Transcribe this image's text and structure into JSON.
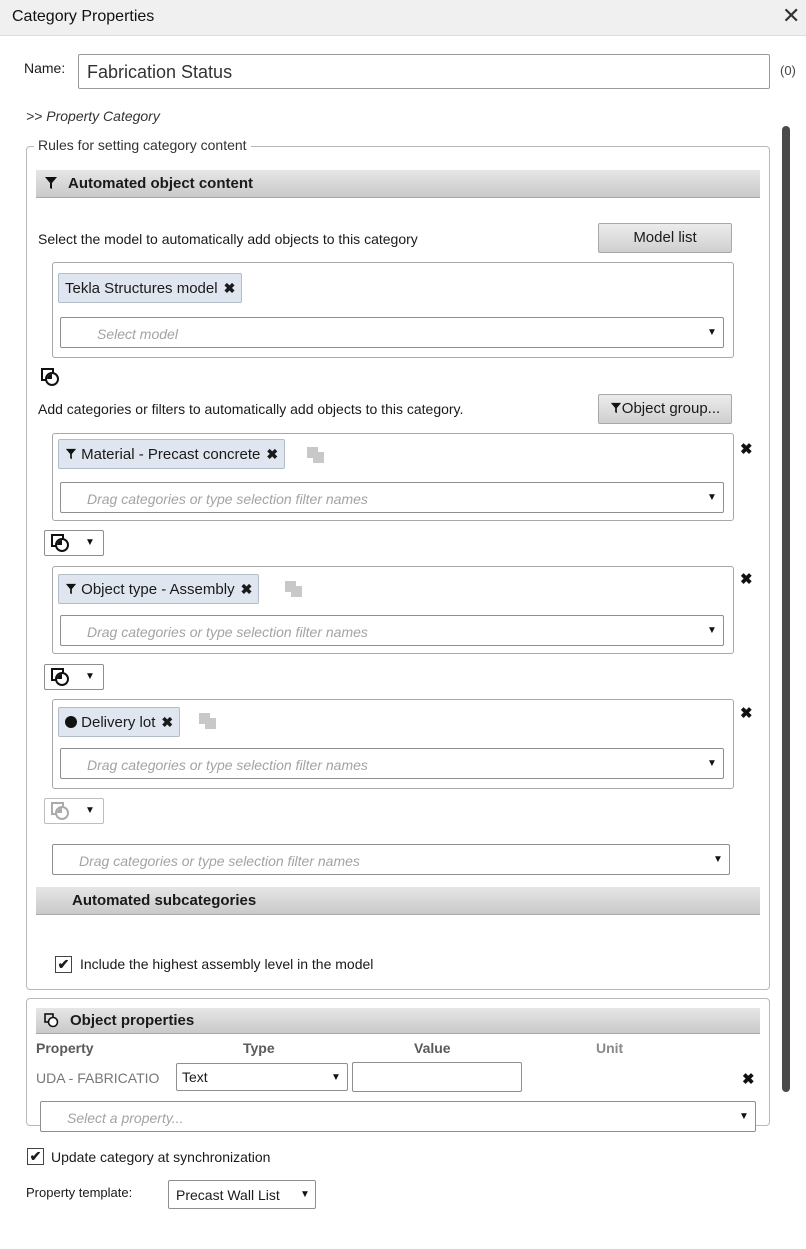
{
  "window": {
    "title": "Category Properties",
    "close": "✕"
  },
  "name": {
    "label": "Name:",
    "value": "Fabrication Status",
    "count": "(0)"
  },
  "property_category_link": ">> Property Category",
  "rules": {
    "legend": "Rules for setting category content",
    "automated_header": "Automated object content",
    "select_model_text": "Select the model to automatically add objects to this category",
    "model_list_button": "Model list",
    "model_tag": "Tekla Structures model",
    "model_placeholder": "Select model",
    "add_categories_text": "Add categories or filters to automatically add objects to this category.",
    "object_group_button": "Object group...",
    "filter_groups": [
      {
        "tag": "Material - Precast concrete",
        "placeholder": "Drag categories or type selection filter names"
      },
      {
        "tag": "Object type - Assembly",
        "placeholder": "Drag categories or type selection filter names"
      },
      {
        "tag": "Delivery lot",
        "placeholder": "Drag categories or type selection filter names"
      }
    ],
    "final_placeholder": "Drag categories or type selection filter names",
    "subcategories_header": "Automated subcategories",
    "include_highest_label": "Include the highest assembly level in the model",
    "include_highest_checked": true
  },
  "object_properties": {
    "header": "Object properties",
    "columns": [
      "Property",
      "Type",
      "Value",
      "Unit"
    ],
    "row": {
      "property": "UDA - FABRICATIO",
      "type": "Text",
      "value": "",
      "unit": ""
    },
    "select_placeholder": "Select a property..."
  },
  "footer": {
    "update_label": "Update category at synchronization",
    "update_checked": true,
    "template_label": "Property template:",
    "template_value": "Precast Wall List"
  },
  "icons": {
    "filter": "filter-icon",
    "remove": "remove-icon",
    "combine": "combine-icon",
    "dropdown": "chevron-down-icon"
  }
}
